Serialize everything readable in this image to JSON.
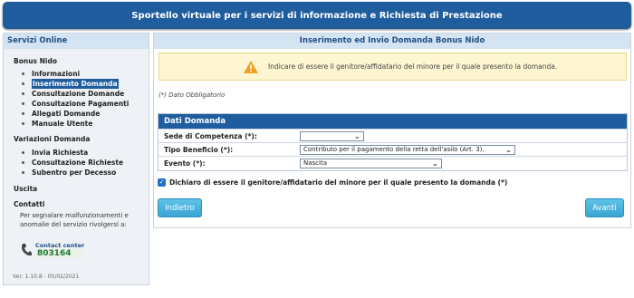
{
  "banner": {
    "title": "Sportello virtuale per i servizi di informazione e Richiesta di Prestazione"
  },
  "sidebar": {
    "title": "Servizi Online",
    "sections": [
      {
        "title": "Bonus Nido",
        "items": [
          "Informazioni",
          "Inserimento Domanda",
          "Consultazione Domande",
          "Consultazione Pagamenti",
          "Allegati Domande",
          "Manuale Utente"
        ]
      },
      {
        "title": "Variazioni Domanda",
        "items": [
          "Invia Richiesta",
          "Consultazione Richieste",
          "Subentro per Decesso"
        ]
      },
      {
        "title": "Uscita",
        "items": []
      },
      {
        "title": "Contatti",
        "items": []
      }
    ],
    "active_item": "Inserimento Domanda",
    "contatti_text": "Per segnalare malfunzionamenti e anomalie del servizio rivolgersi a:",
    "contact_center_label": "Contact center",
    "contact_center_number": "803164",
    "version": "Ver: 1.10.8 - 05/02/2021"
  },
  "main": {
    "title": "Inserimento ed Invio Domanda Bonus Nido",
    "warning": "Indicare di essere il genitore/affidatario del minore per il quale presento la domanda.",
    "obbligatorio": "(*) Dato Obbligatorio",
    "form": {
      "title": "Dati Domanda",
      "fields": [
        {
          "label": "Sede di Competenza (*):",
          "value": ""
        },
        {
          "label": "Tipo Beneficio (*):",
          "value": "Contributo per il pagamento della retta dell'asilo (Art. 3)."
        },
        {
          "label": "Evento (*):",
          "value": "Nascita"
        }
      ]
    },
    "checkbox_label": "Dichiaro di essere il genitore/affidatario del minore per il quale presento la domanda (*)",
    "checkbox_checked": true,
    "back_button": "Indietro",
    "next_button": "Avanti"
  },
  "colors": {
    "primary": "#1f5d9e",
    "button": "#3aa4d4",
    "warning_bg": "#fdf6d1",
    "warning_icon": "#f0a020"
  }
}
